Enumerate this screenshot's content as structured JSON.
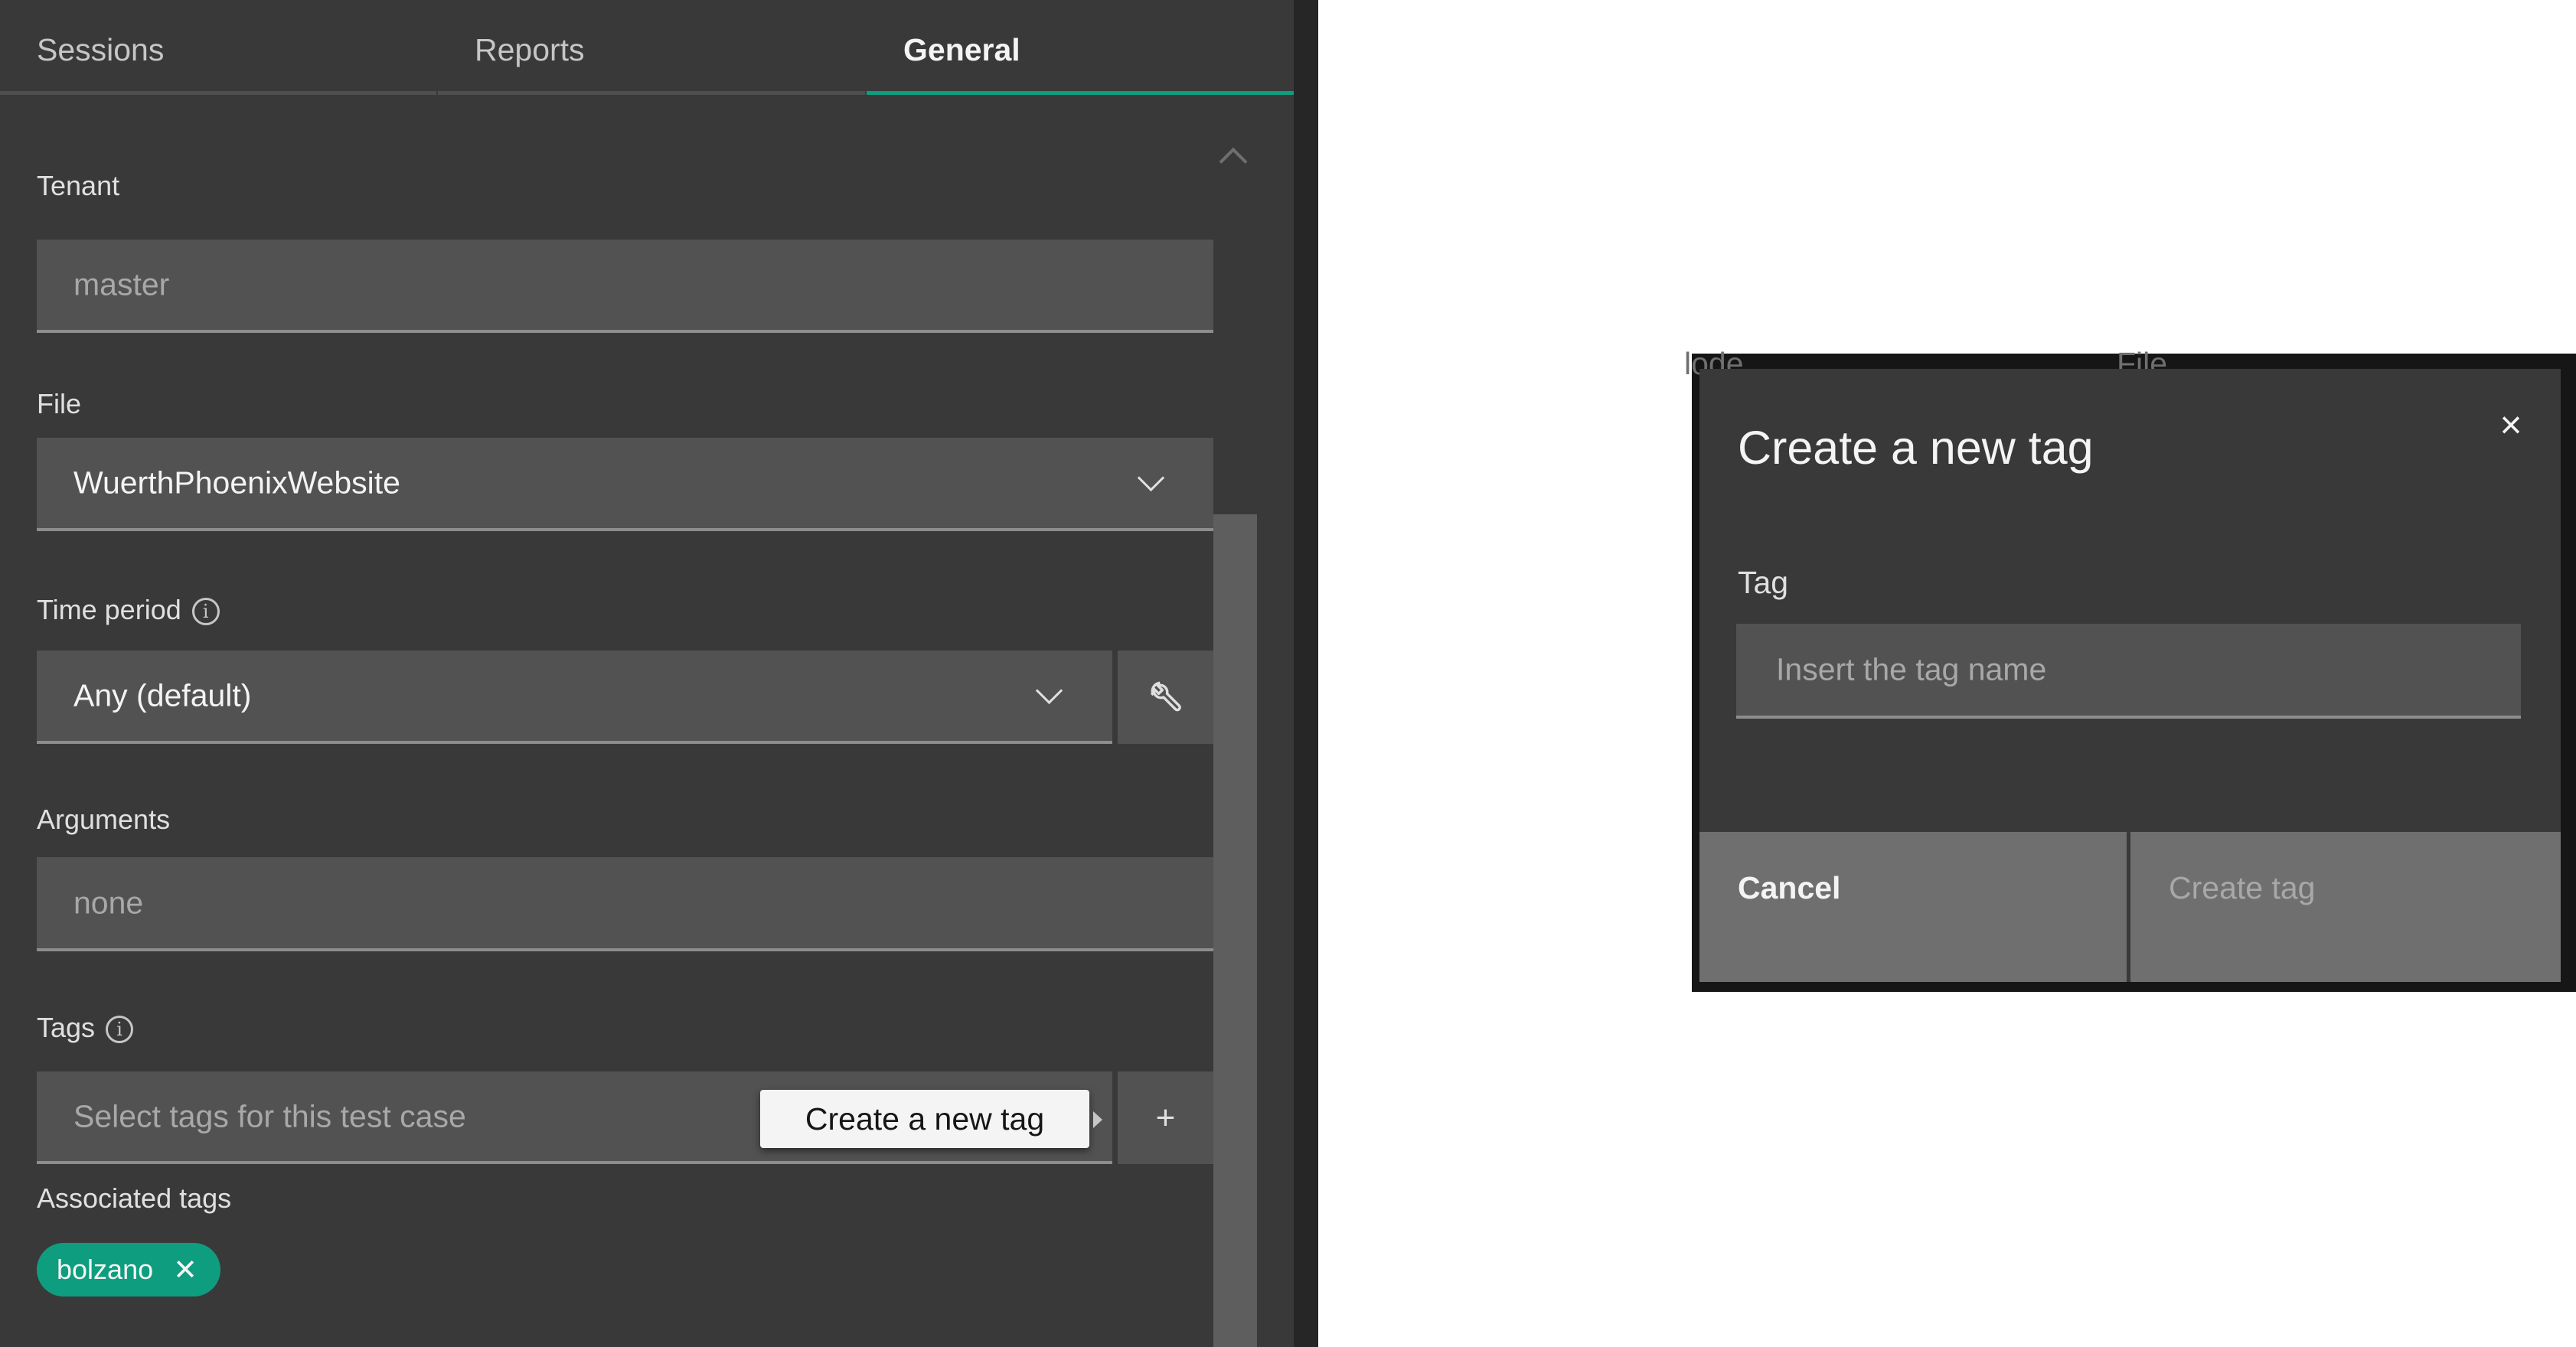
{
  "tabs": [
    {
      "label": "Sessions",
      "active": false
    },
    {
      "label": "Reports",
      "active": false
    },
    {
      "label": "General",
      "active": true
    }
  ],
  "form": {
    "tenant": {
      "label": "Tenant",
      "value": "master"
    },
    "file": {
      "label": "File",
      "value": "WuerthPhoenixWebsite"
    },
    "time_period": {
      "label": "Time period",
      "value": "Any (default)"
    },
    "arguments": {
      "label": "Arguments",
      "value": "none"
    },
    "tags": {
      "label": "Tags",
      "placeholder": "Select tags for this test case",
      "add_tooltip": "Create a new tag",
      "add_symbol": "+"
    },
    "associated_tags": {
      "label": "Associated tags",
      "items": [
        {
          "name": "bolzano"
        }
      ]
    }
  },
  "icons": {
    "info": "i",
    "close": "×",
    "chip_remove": "✕"
  },
  "colors": {
    "accent": "#0f9d7f",
    "panel": "#393939",
    "field": "#525252"
  },
  "backdrop": {
    "col1_header": "lode",
    "col2_header": "File"
  },
  "modal": {
    "title": "Create a new tag",
    "tag_label": "Tag",
    "tag_placeholder": "Insert the tag name",
    "tag_value": "",
    "cancel_label": "Cancel",
    "create_label": "Create tag",
    "create_disabled": true
  }
}
